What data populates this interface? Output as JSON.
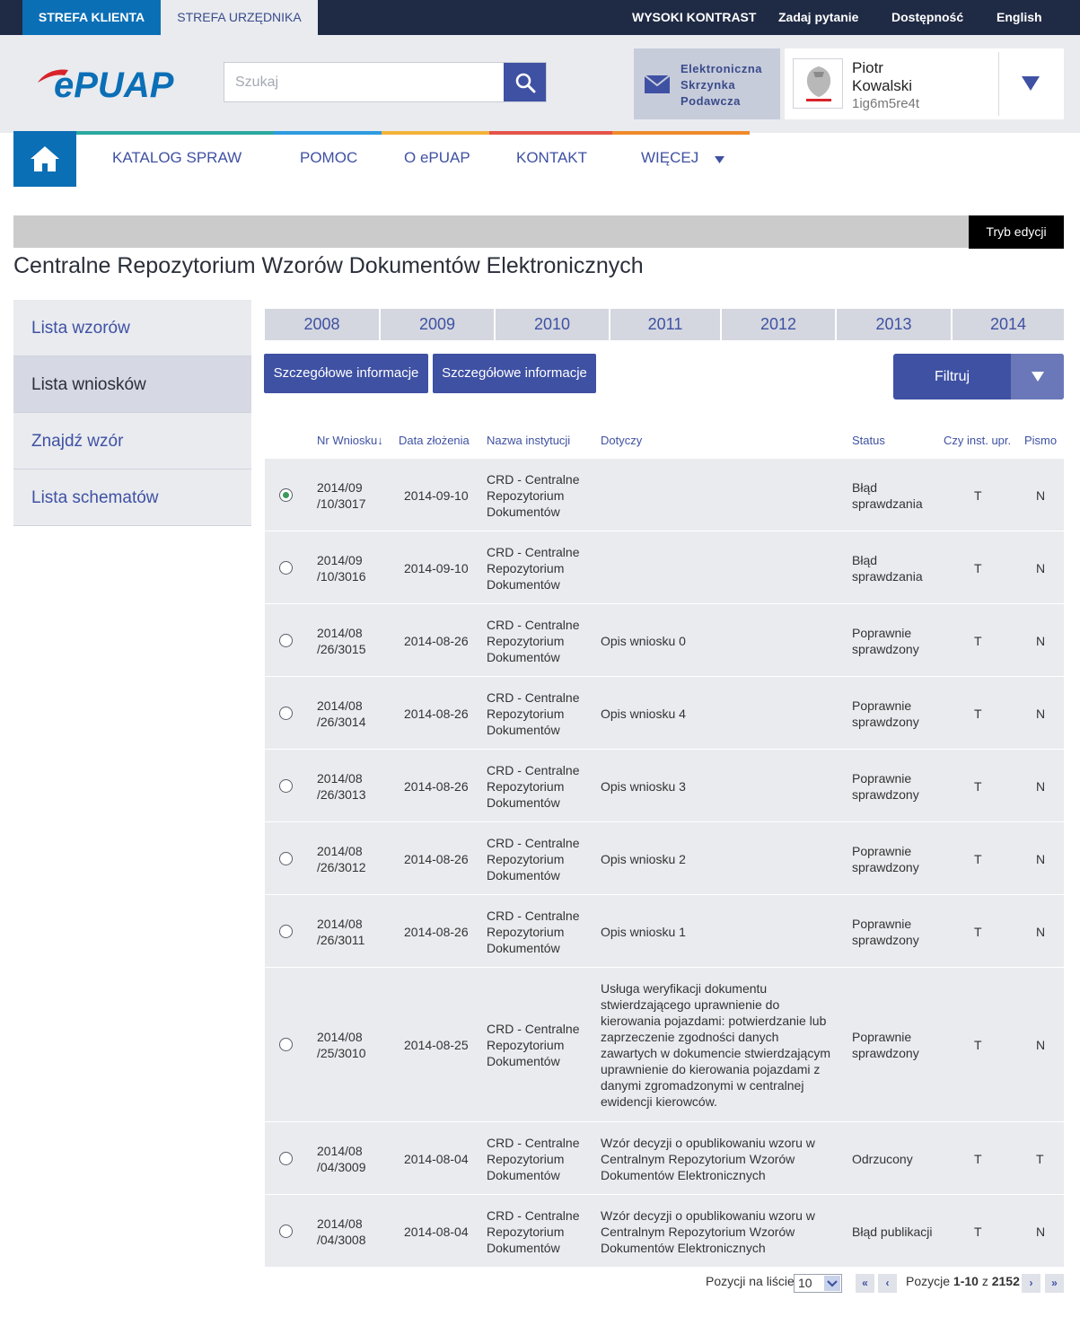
{
  "topbar": {
    "tab_klient": "STREFA KLIENTA",
    "tab_urzednik": "STREFA URZĘDNIKA",
    "links": [
      "WYSOKI KONTRAST",
      "Zadaj pytanie",
      "Dostępność",
      "English"
    ]
  },
  "header": {
    "logo_text": "ePUAP",
    "search_placeholder": "Szukaj",
    "esp_label": "Elektroniczna Skrzynka Podawcza",
    "user_first": "Piotr",
    "user_last": "Kowalski",
    "user_id": "1ig6m5re4t"
  },
  "nav": {
    "items": [
      "KATALOG SPRAW",
      "POMOC",
      "O ePUAP",
      "KONTAKT",
      "WIĘCEJ"
    ]
  },
  "edit_mode": "Tryb edycji",
  "page_title": "Centralne Repozytorium Wzorów Dokumentów Elektronicznych",
  "sidebar": {
    "items": [
      "Lista wzorów",
      "Lista wniosków",
      "Znajdź wzór",
      "Lista schematów"
    ],
    "active": "Lista wniosków"
  },
  "years": [
    "2008",
    "2009",
    "2010",
    "2011",
    "2012",
    "2013",
    "2014"
  ],
  "buttons": {
    "info1": "Szczegółowe informacje",
    "info2": "Szczegółowe informacje",
    "filter": "Filtruj"
  },
  "table": {
    "headers": [
      "Nr Wniosku",
      "Data złożenia",
      "Nazwa instytucji",
      "Dotyczy",
      "Status",
      "Czy inst. upr.",
      "Pismo"
    ],
    "sort_indicator": "↓",
    "rows": [
      {
        "nr1": "2014/09",
        "nr2": "/10/3017",
        "date": "2014-09-10",
        "inst": [
          "CRD - Centralne",
          "Repozytorium",
          "Dokumentów"
        ],
        "dotyczy": [],
        "status": [
          "Błąd",
          "sprawdzania"
        ],
        "upr": "T",
        "pismo": "N",
        "selected": true
      },
      {
        "nr1": "2014/09",
        "nr2": "/10/3016",
        "date": "2014-09-10",
        "inst": [
          "CRD - Centralne",
          "Repozytorium",
          "Dokumentów"
        ],
        "dotyczy": [],
        "status": [
          "Błąd",
          "sprawdzania"
        ],
        "upr": "T",
        "pismo": "N",
        "selected": false
      },
      {
        "nr1": "2014/08",
        "nr2": "/26/3015",
        "date": "2014-08-26",
        "inst": [
          "CRD - Centralne",
          "Repozytorium",
          "Dokumentów"
        ],
        "dotyczy": [
          "Opis wniosku 0"
        ],
        "status": [
          "Poprawnie",
          "sprawdzony"
        ],
        "upr": "T",
        "pismo": "N",
        "selected": false
      },
      {
        "nr1": "2014/08",
        "nr2": "/26/3014",
        "date": "2014-08-26",
        "inst": [
          "CRD - Centralne",
          "Repozytorium",
          "Dokumentów"
        ],
        "dotyczy": [
          "Opis wniosku 4"
        ],
        "status": [
          "Poprawnie",
          "sprawdzony"
        ],
        "upr": "T",
        "pismo": "N",
        "selected": false
      },
      {
        "nr1": "2014/08",
        "nr2": "/26/3013",
        "date": "2014-08-26",
        "inst": [
          "CRD - Centralne",
          "Repozytorium",
          "Dokumentów"
        ],
        "dotyczy": [
          "Opis wniosku 3"
        ],
        "status": [
          "Poprawnie",
          "sprawdzony"
        ],
        "upr": "T",
        "pismo": "N",
        "selected": false
      },
      {
        "nr1": "2014/08",
        "nr2": "/26/3012",
        "date": "2014-08-26",
        "inst": [
          "CRD - Centralne",
          "Repozytorium",
          "Dokumentów"
        ],
        "dotyczy": [
          "Opis wniosku 2"
        ],
        "status": [
          "Poprawnie",
          "sprawdzony"
        ],
        "upr": "T",
        "pismo": "N",
        "selected": false
      },
      {
        "nr1": "2014/08",
        "nr2": "/26/3011",
        "date": "2014-08-26",
        "inst": [
          "CRD - Centralne",
          "Repozytorium",
          "Dokumentów"
        ],
        "dotyczy": [
          "Opis wniosku 1"
        ],
        "status": [
          "Poprawnie",
          "sprawdzony"
        ],
        "upr": "T",
        "pismo": "N",
        "selected": false
      },
      {
        "nr1": "2014/08",
        "nr2": "/25/3010",
        "date": "2014-08-25",
        "inst": [
          "CRD - Centralne",
          "Repozytorium",
          "Dokumentów"
        ],
        "dotyczy": [
          "Usługa weryfikacji dokumentu",
          "stwierdzającego uprawnienie do",
          "kierowania pojazdami: potwierdzanie lub",
          "zaprzeczenie zgodności danych",
          "zawartych w dokumencie stwierdzającym",
          "uprawnienie do kierowania pojazdami z",
          "danymi zgromadzonymi w centralnej",
          "ewidencji kierowców."
        ],
        "status": [
          "Poprawnie",
          "sprawdzony"
        ],
        "upr": "T",
        "pismo": "N",
        "selected": false
      },
      {
        "nr1": "2014/08",
        "nr2": "/04/3009",
        "date": "2014-08-04",
        "inst": [
          "CRD - Centralne",
          "Repozytorium",
          "Dokumentów"
        ],
        "dotyczy": [
          "Wzór decyzji o opublikowaniu wzoru w",
          "Centralnym Repozytorium Wzorów",
          "Dokumentów Elektronicznych"
        ],
        "status": [
          "Odrzucony"
        ],
        "upr": "T",
        "pismo": "T",
        "selected": false
      },
      {
        "nr1": "2014/08",
        "nr2": "/04/3008",
        "date": "2014-08-04",
        "inst": [
          "CRD - Centralne",
          "Repozytorium",
          "Dokumentów"
        ],
        "dotyczy": [
          "Wzór decyzji o opublikowaniu wzoru w",
          "Centralnym Repozytorium Wzorów",
          "Dokumentów Elektronicznych"
        ],
        "status": [
          "Błąd publikacji"
        ],
        "upr": "T",
        "pismo": "N",
        "selected": false
      }
    ]
  },
  "pagination": {
    "per_page_label": "Pozycji na liście",
    "per_page_value": "10",
    "range_prefix": "Pozycje",
    "range": "1-10",
    "of": "z",
    "total": "2152",
    "first": "«",
    "prev": "‹",
    "next": "›",
    "last": "»"
  },
  "colors": {
    "primary": "#3f51a3",
    "topbar": "#1f2a44",
    "accent_blue": "#0b6fb6",
    "light_bg": "#e9ebef"
  }
}
